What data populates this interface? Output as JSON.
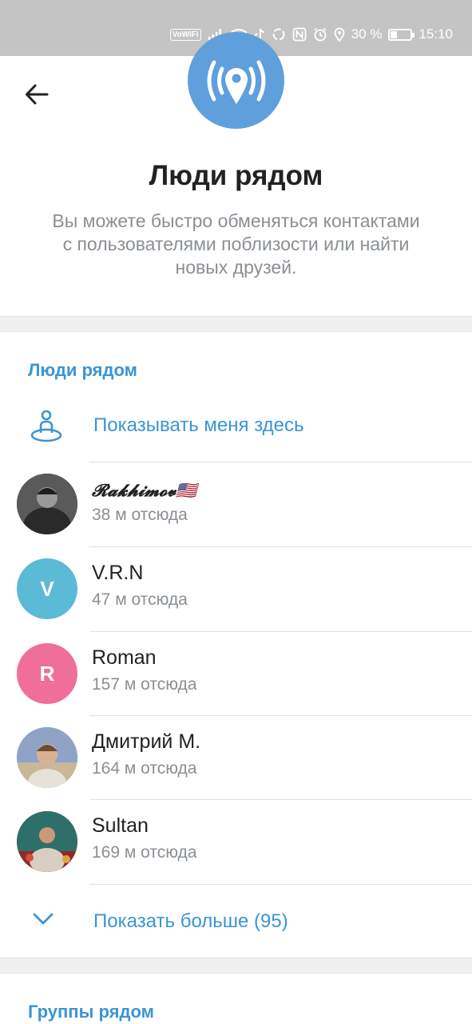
{
  "status_bar": {
    "wifi_badge": "VoWiFi",
    "battery_percent": "30 %",
    "battery_level": 0.3,
    "time": "15:10"
  },
  "header": {
    "title": "Люди рядом",
    "description": "Вы можете быстро обменяться контактами с пользователями поблизости или найти новых друзей."
  },
  "people_section": {
    "title": "Люди рядом",
    "show_me_label": "Показывать меня здесь",
    "people": [
      {
        "name": "𝓡𝓪𝓴𝓱𝓲𝓶𝓸𝓿",
        "flag": "🇺🇸",
        "distance": "38 м отсюда",
        "avatar_type": "photo",
        "avatar_color": "#3b3b3b"
      },
      {
        "name": "V.R.N",
        "distance": "47 м отсюда",
        "avatar_type": "initial",
        "initial": "V",
        "avatar_color": "#5bbad5"
      },
      {
        "name": "Roman",
        "distance": "157 м отсюда",
        "avatar_type": "initial",
        "initial": "R",
        "avatar_color": "#ef6f9a"
      },
      {
        "name": "Дмитрий М.",
        "distance": "164 м отсюда",
        "avatar_type": "photo",
        "avatar_color": "#b9a58a"
      },
      {
        "name": "Sultan",
        "distance": "169 м отсюда",
        "avatar_type": "photo",
        "avatar_color": "#7a3b2e"
      }
    ],
    "show_more_label": "Показать больше (95)"
  },
  "groups_section": {
    "title": "Группы рядом"
  },
  "colors": {
    "accent": "#3a95d5",
    "hero_icon_bg": "#5f9fdb",
    "status_bar_bg": "#c4c4c4",
    "secondary_text": "#8a8f94"
  },
  "icons": {
    "back": "arrow-left-icon",
    "hero": "location-broadcast-icon",
    "show_me": "person-on-location-icon",
    "show_more": "chevron-down-icon"
  }
}
